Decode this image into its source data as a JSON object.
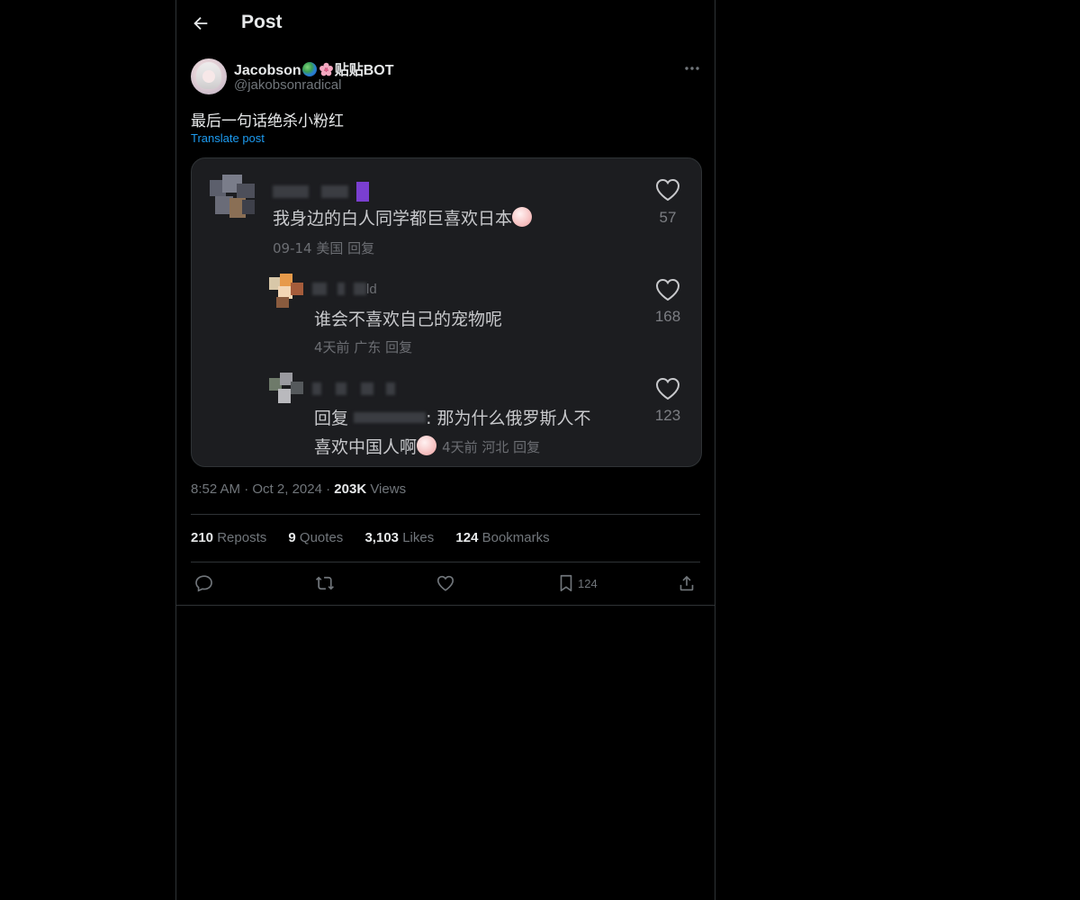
{
  "header": {
    "title": "Post"
  },
  "author": {
    "name": "Jacobson",
    "name_suffix": "贴贴BOT",
    "handle": "@jakobsonradical"
  },
  "post": {
    "text": "最后一句话绝杀小粉红",
    "translate_label": "Translate post"
  },
  "media": {
    "comments": [
      {
        "text": "我身边的白人同学都巨喜欢日本",
        "meta": "09-14 美国 回复",
        "likes": "57"
      },
      {
        "name_partial": "ld",
        "text": "谁会不喜欢自己的宠物呢",
        "meta": "4天前 广东 回复",
        "likes": "168"
      },
      {
        "text_prefix": "回复",
        "text_rest": ": 那为什么俄罗斯人不",
        "text_line2": "喜欢中国人啊",
        "meta": "4天前 河北 回复",
        "likes": "123"
      }
    ]
  },
  "meta": {
    "time": "8:52 AM",
    "dot": "·",
    "date": "Oct 2, 2024",
    "views_count": "203K",
    "views_label": "Views"
  },
  "stats": {
    "reposts_count": "210",
    "reposts_label": "Reposts",
    "quotes_count": "9",
    "quotes_label": "Quotes",
    "likes_count": "3,103",
    "likes_label": "Likes",
    "bookmarks_count": "124",
    "bookmarks_label": "Bookmarks"
  },
  "actions": {
    "bookmark_count": "124",
    "icons": [
      "reply-icon",
      "repost-icon",
      "like-icon",
      "bookmark-icon",
      "share-icon"
    ]
  },
  "colors": {
    "background": "#000000",
    "link": "#1d9bf0",
    "muted": "#71767b",
    "text": "#e7e9ea"
  }
}
